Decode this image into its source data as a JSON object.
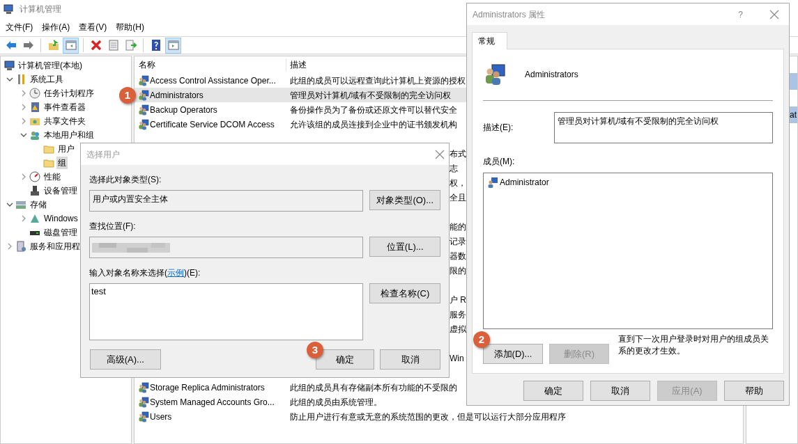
{
  "main_window": {
    "title": "计算机管理",
    "menu": [
      "文件(F)",
      "操作(A)",
      "查看(V)",
      "帮助(H)"
    ],
    "toolbar": [
      {
        "kind": "back",
        "pressed": false
      },
      {
        "kind": "forward",
        "pressed": false
      },
      {
        "kind": "sep"
      },
      {
        "kind": "up",
        "pressed": false
      },
      {
        "kind": "tree",
        "pressed": true
      },
      {
        "kind": "sep"
      },
      {
        "kind": "delete",
        "pressed": false
      },
      {
        "kind": "props",
        "pressed": false
      },
      {
        "kind": "export",
        "pressed": false
      },
      {
        "kind": "sep"
      },
      {
        "kind": "help",
        "pressed": false
      },
      {
        "kind": "pane",
        "pressed": true
      }
    ],
    "tree": [
      {
        "label": "计算机管理(本地)",
        "kind": "computer",
        "selected": false,
        "children": [
          {
            "label": "系统工具",
            "kind": "tools",
            "expanded": true,
            "selected": false,
            "children": [
              {
                "label": "任务计划程序",
                "kind": "clock",
                "expanded": false,
                "selected": false
              },
              {
                "label": "事件查看器",
                "kind": "log",
                "expanded": false,
                "selected": false
              },
              {
                "label": "共享文件夹",
                "kind": "share",
                "expanded": false,
                "selected": false
              },
              {
                "label": "本地用户和组",
                "kind": "users",
                "expanded": true,
                "selected": false,
                "children": [
                  {
                    "label": "用户",
                    "kind": "folder",
                    "selected": false
                  },
                  {
                    "label": "组",
                    "kind": "folder",
                    "selected": true
                  }
                ]
              },
              {
                "label": "性能",
                "kind": "gauge",
                "expanded": false,
                "selected": false
              },
              {
                "label": "设备管理",
                "kind": "device",
                "selected": false
              }
            ]
          },
          {
            "label": "存储",
            "kind": "storage",
            "expanded": true,
            "selected": false,
            "children": [
              {
                "label": "Windows",
                "kind": "backup",
                "expanded": false,
                "selected": false
              },
              {
                "label": "磁盘管理",
                "kind": "disk",
                "selected": false
              }
            ]
          },
          {
            "label": "服务和应用程",
            "kind": "services",
            "expanded": false,
            "selected": false
          }
        ]
      }
    ],
    "list": {
      "columns": [
        "名称",
        "描述"
      ],
      "rows": [
        {
          "kind": "full",
          "name": "Access Control Assistance Oper...",
          "description": "此组的成员可以远程查询此计算机上资源的授权",
          "selected": false
        },
        {
          "kind": "full",
          "name": "Administrators",
          "description": "管理员对计算机/域有不受限制的完全访问权",
          "selected": true
        },
        {
          "kind": "full",
          "name": "Backup Operators",
          "description": "备份操作员为了备份或还原文件可以替代安全",
          "selected": false
        },
        {
          "kind": "full",
          "name": "Certificate Service DCOM Access",
          "description": "允许该组的成员连接到企业中的证书颁发机构",
          "selected": false
        },
        {
          "kind": "covered"
        },
        {
          "kind": "covered",
          "fragment": "布式"
        },
        {
          "kind": "covered",
          "fragment": "志"
        },
        {
          "kind": "covered",
          "fragment": "权，"
        },
        {
          "kind": "covered",
          "fragment": "全且"
        },
        {
          "kind": "covered"
        },
        {
          "kind": "covered",
          "fragment": "能的"
        },
        {
          "kind": "covered",
          "fragment": "记录"
        },
        {
          "kind": "covered",
          "fragment": "器数"
        },
        {
          "kind": "covered",
          "fragment": "限的"
        },
        {
          "kind": "covered"
        },
        {
          "kind": "covered",
          "fragment": "户 R"
        },
        {
          "kind": "covered",
          "fragment": "服务"
        },
        {
          "kind": "covered",
          "fragment": "虚拟"
        },
        {
          "kind": "covered"
        },
        {
          "kind": "covered",
          "fragment": "Win"
        },
        {
          "kind": "covered"
        },
        {
          "kind": "full",
          "name": "Storage Replica Administrators",
          "description": "此组的成员具有存储副本所有功能的不受限的",
          "selected": false
        },
        {
          "kind": "full",
          "name": "System Managed Accounts Gro...",
          "description": "此组的成员由系统管理。",
          "selected": false
        },
        {
          "kind": "full",
          "name": "Users",
          "description": "防止用户进行有意或无意的系统范围的更改，但是可以运行大部分应用程序",
          "selected": false
        }
      ]
    },
    "actions": [
      {
        "kind": "header"
      },
      {
        "kind": "text"
      },
      {
        "kind": "header",
        "fragment": "at"
      },
      {
        "kind": "text"
      }
    ]
  },
  "select_user_dialog": {
    "title": "选择用户",
    "object_type_label": "选择此对象类型(S):",
    "object_type_value": "用户或内置安全主体",
    "object_type_button": "对象类型(O)...",
    "location_label": "查找位置(F):",
    "location_button": "位置(L)...",
    "names_label_before": "输入对象名称来选择(",
    "names_link": "示例",
    "names_label_after": ")(E):",
    "names_value": "test",
    "check_button": "检查名称(C)",
    "advanced_button": "高级(A)...",
    "ok_button": "确定",
    "cancel_button": "取消"
  },
  "properties_dialog": {
    "title": "Administrators 属性",
    "help": "?",
    "tabs": [
      {
        "label": "常规",
        "selected": true
      }
    ],
    "group_name": "Administrators",
    "description_label": "描述(E):",
    "description_value": "管理员对计算机/域有不受限制的完全访问权",
    "members_label": "成员(M):",
    "members": [
      "Administrator"
    ],
    "add_button": {
      "label": "添加(D)...",
      "disabled": false
    },
    "remove_button": {
      "label": "删除(R)",
      "disabled": true
    },
    "note": "直到下一次用户登录时对用户的组成员关系的更改才生效。",
    "buttons": [
      {
        "label": "确定",
        "disabled": false
      },
      {
        "label": "取消",
        "disabled": false
      },
      {
        "label": "应用(A)",
        "disabled": true
      },
      {
        "label": "帮助",
        "disabled": false
      }
    ]
  },
  "annotations": [
    "1",
    "2",
    "3"
  ]
}
